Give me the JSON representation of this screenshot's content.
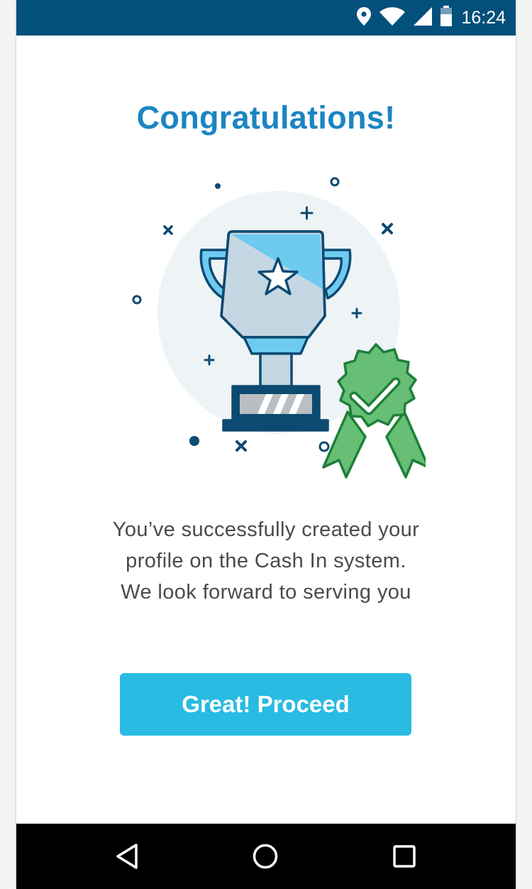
{
  "status_bar": {
    "time": "16:24",
    "icons": [
      "location-icon",
      "wifi-icon",
      "cell-signal-icon",
      "battery-icon"
    ],
    "background": "#04507c"
  },
  "main": {
    "title": "Congratulations!",
    "message_lines": [
      "You’ve successfully created your",
      "profile on the Cash In system.",
      "We look forward to serving you"
    ],
    "illustration": {
      "icons": [
        "trophy-icon",
        "star-icon",
        "award-badge-icon",
        "checkmark-icon"
      ]
    }
  },
  "actions": {
    "proceed_label": "Great! Proceed"
  },
  "nav_bar": {
    "icons": [
      "back-icon",
      "home-icon",
      "recents-icon"
    ]
  },
  "colors": {
    "title": "#1b85c1",
    "button": "#29bbe2",
    "badge_green": "#66bf74",
    "trophy_outline": "#0d4a72"
  }
}
